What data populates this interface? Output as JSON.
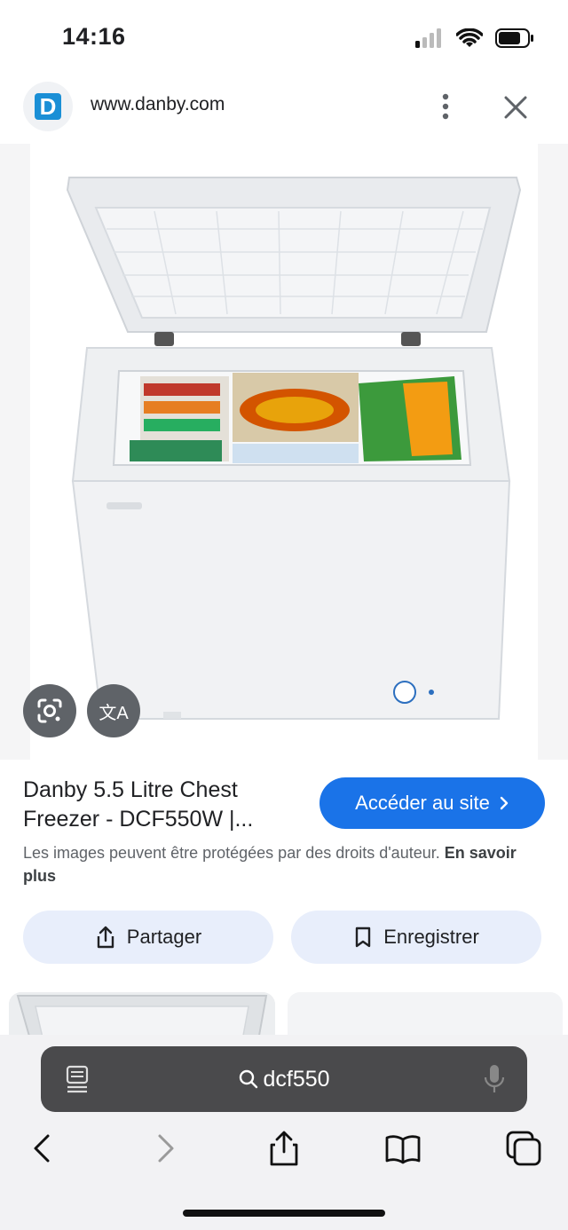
{
  "status_bar": {
    "time": "14:16"
  },
  "header": {
    "url": "www.danby.com",
    "logo_letter": "D"
  },
  "product": {
    "title": "Danby 5.5 Litre Chest Freezer - DCF550W |...",
    "visit_label": "Accéder au site",
    "copyright_text": "Les images peuvent être protégées par des droits d'auteur.",
    "learn_more": "En savoir plus",
    "share_label": "Partager",
    "save_label": "Enregistrer"
  },
  "image_labels": {
    "translate_glyph": "文A"
  },
  "browser": {
    "search_query": "dcf550"
  },
  "icons": [
    "lens-icon",
    "translate-icon",
    "share-icon",
    "bookmark-icon",
    "more-vert-icon",
    "close-icon",
    "tabs-icon",
    "mic-icon",
    "back-icon",
    "forward-icon",
    "share-icon",
    "bookmarks-icon",
    "tabs-overview-icon"
  ],
  "colors": {
    "accent": "#1a73e8",
    "pill": "#e8eefb",
    "logo": "#1a8fd6"
  }
}
